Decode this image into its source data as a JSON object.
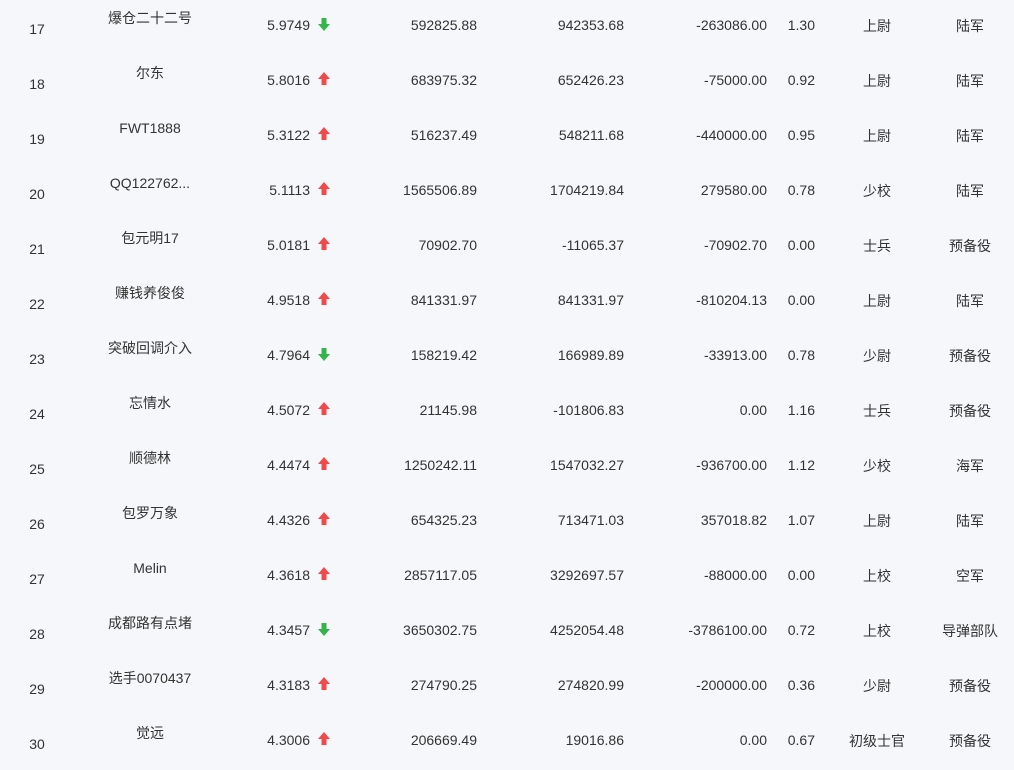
{
  "colors": {
    "up": "#f04a4a",
    "down": "#36b34a"
  },
  "rows": [
    {
      "rank": "17",
      "name": "爆仓二十二号",
      "score": "5.9749",
      "dir": "down",
      "a": "592825.88",
      "b": "942353.68",
      "c": "-263086.00",
      "d": "1.30",
      "title": "上尉",
      "branch": "陆军"
    },
    {
      "rank": "18",
      "name": "尔东",
      "score": "5.8016",
      "dir": "up",
      "a": "683975.32",
      "b": "652426.23",
      "c": "-75000.00",
      "d": "0.92",
      "title": "上尉",
      "branch": "陆军"
    },
    {
      "rank": "19",
      "name": "FWT1888",
      "score": "5.3122",
      "dir": "up",
      "a": "516237.49",
      "b": "548211.68",
      "c": "-440000.00",
      "d": "0.95",
      "title": "上尉",
      "branch": "陆军"
    },
    {
      "rank": "20",
      "name": "QQ122762...",
      "score": "5.1113",
      "dir": "up",
      "a": "1565506.89",
      "b": "1704219.84",
      "c": "279580.00",
      "d": "0.78",
      "title": "少校",
      "branch": "陆军"
    },
    {
      "rank": "21",
      "name": "包元明17",
      "score": "5.0181",
      "dir": "up",
      "a": "70902.70",
      "b": "-11065.37",
      "c": "-70902.70",
      "d": "0.00",
      "title": "士兵",
      "branch": "预备役"
    },
    {
      "rank": "22",
      "name": "赚钱养俊俊",
      "score": "4.9518",
      "dir": "up",
      "a": "841331.97",
      "b": "841331.97",
      "c": "-810204.13",
      "d": "0.00",
      "title": "上尉",
      "branch": "陆军"
    },
    {
      "rank": "23",
      "name": "突破回调介入",
      "score": "4.7964",
      "dir": "down",
      "a": "158219.42",
      "b": "166989.89",
      "c": "-33913.00",
      "d": "0.78",
      "title": "少尉",
      "branch": "预备役"
    },
    {
      "rank": "24",
      "name": "忘情水",
      "score": "4.5072",
      "dir": "up",
      "a": "21145.98",
      "b": "-101806.83",
      "c": "0.00",
      "d": "1.16",
      "title": "士兵",
      "branch": "预备役"
    },
    {
      "rank": "25",
      "name": "顺德林",
      "score": "4.4474",
      "dir": "up",
      "a": "1250242.11",
      "b": "1547032.27",
      "c": "-936700.00",
      "d": "1.12",
      "title": "少校",
      "branch": "海军"
    },
    {
      "rank": "26",
      "name": "包罗万象",
      "score": "4.4326",
      "dir": "up",
      "a": "654325.23",
      "b": "713471.03",
      "c": "357018.82",
      "d": "1.07",
      "title": "上尉",
      "branch": "陆军"
    },
    {
      "rank": "27",
      "name": "Melin",
      "score": "4.3618",
      "dir": "up",
      "a": "2857117.05",
      "b": "3292697.57",
      "c": "-88000.00",
      "d": "0.00",
      "title": "上校",
      "branch": "空军"
    },
    {
      "rank": "28",
      "name": "成都路有点堵",
      "score": "4.3457",
      "dir": "down",
      "a": "3650302.75",
      "b": "4252054.48",
      "c": "-3786100.00",
      "d": "0.72",
      "title": "上校",
      "branch": "导弹部队"
    },
    {
      "rank": "29",
      "name": "选手0070437",
      "score": "4.3183",
      "dir": "up",
      "a": "274790.25",
      "b": "274820.99",
      "c": "-200000.00",
      "d": "0.36",
      "title": "少尉",
      "branch": "预备役"
    },
    {
      "rank": "30",
      "name": "觉远",
      "score": "4.3006",
      "dir": "up",
      "a": "206669.49",
      "b": "19016.86",
      "c": "0.00",
      "d": "0.67",
      "title": "初级士官",
      "branch": "预备役"
    }
  ]
}
